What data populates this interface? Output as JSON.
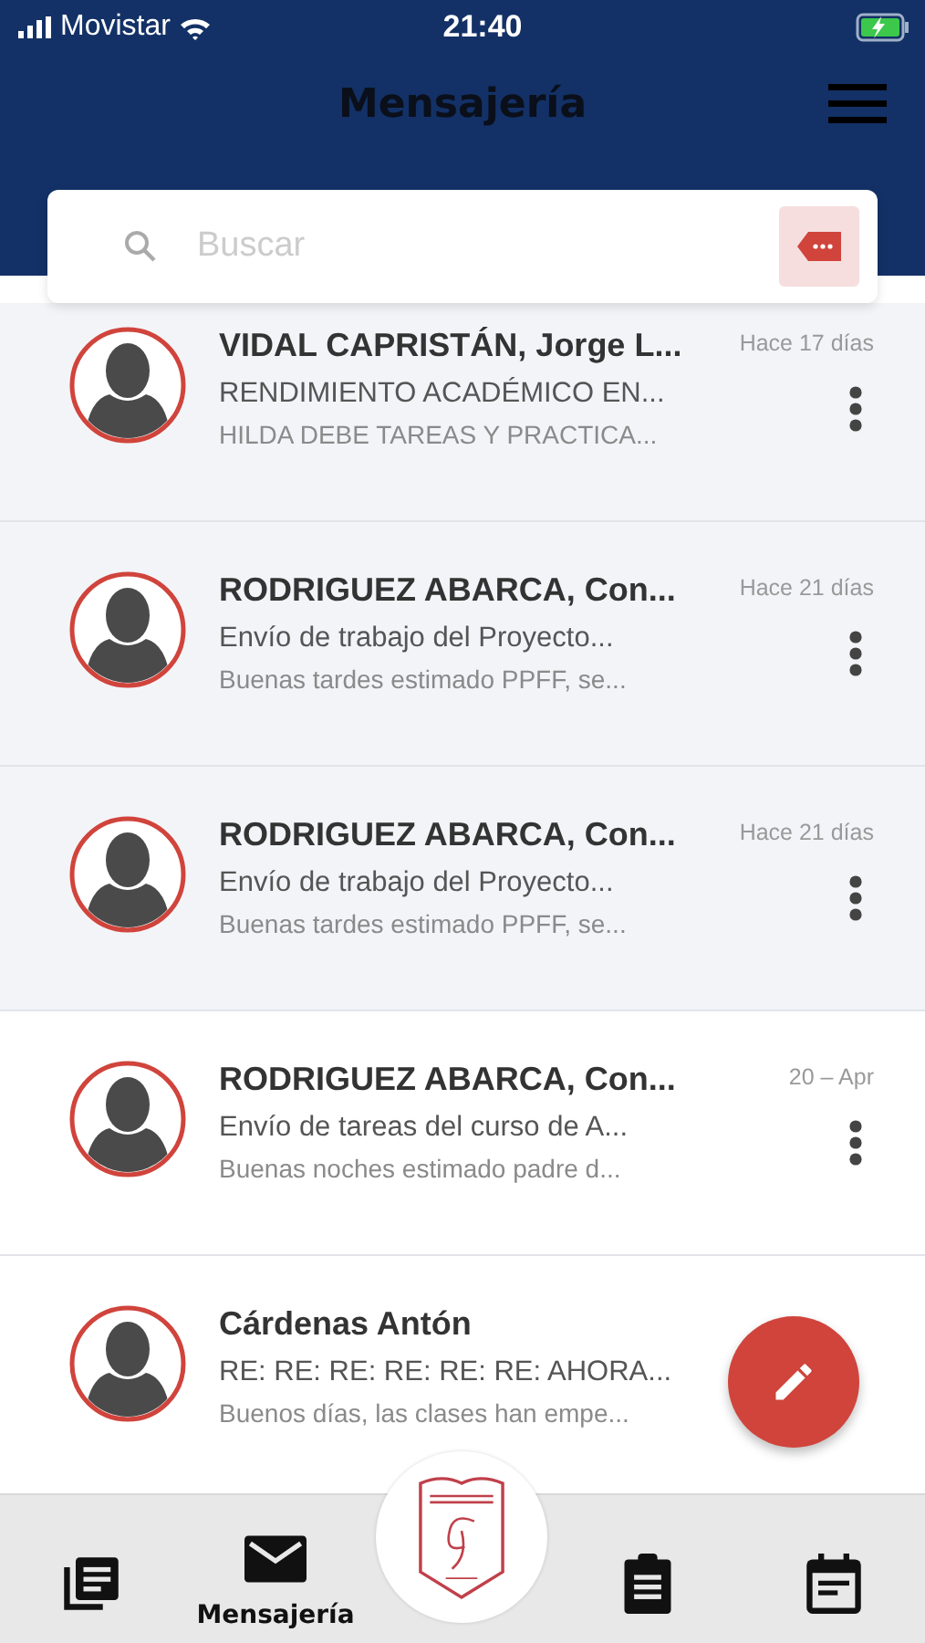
{
  "status_bar": {
    "carrier": "Movistar",
    "time": "21:40",
    "charging": true
  },
  "header": {
    "title": "Mensajería"
  },
  "search": {
    "placeholder": "Buscar"
  },
  "messages": [
    {
      "name": "VIDAL CAPRISTÁN, Jorge L...",
      "subject": "RENDIMIENTO ACADÉMICO EN...",
      "preview": "HILDA DEBE TAREAS Y PRACTICA...",
      "date": "Hace 17 días",
      "unread": true
    },
    {
      "name": "RODRIGUEZ ABARCA, Con...",
      "subject": "Envío de trabajo del Proyecto...",
      "preview": "Buenas tardes estimado PPFF, se...",
      "date": "Hace 21 días",
      "unread": true
    },
    {
      "name": "RODRIGUEZ ABARCA, Con...",
      "subject": "Envío de trabajo del Proyecto...",
      "preview": "Buenas tardes estimado PPFF, se...",
      "date": "Hace 21 días",
      "unread": true
    },
    {
      "name": "RODRIGUEZ ABARCA, Con...",
      "subject": "Envío de tareas del curso de A...",
      "preview": "Buenas noches estimado padre d...",
      "date": "20 – Apr",
      "unread": false
    },
    {
      "name": "Cárdenas Antón",
      "subject": "RE: RE: RE: RE: RE: RE: AHORA...",
      "preview": "Buenos días, las clases han empe...",
      "unread": false
    }
  ],
  "nav": [
    {
      "kind": "news",
      "selected": false
    },
    {
      "kind": "mail",
      "label": "Mensajería",
      "selected": true
    },
    {
      "kind": "logo"
    },
    {
      "kind": "clipboard",
      "selected": false
    },
    {
      "kind": "calendar",
      "selected": false
    }
  ]
}
